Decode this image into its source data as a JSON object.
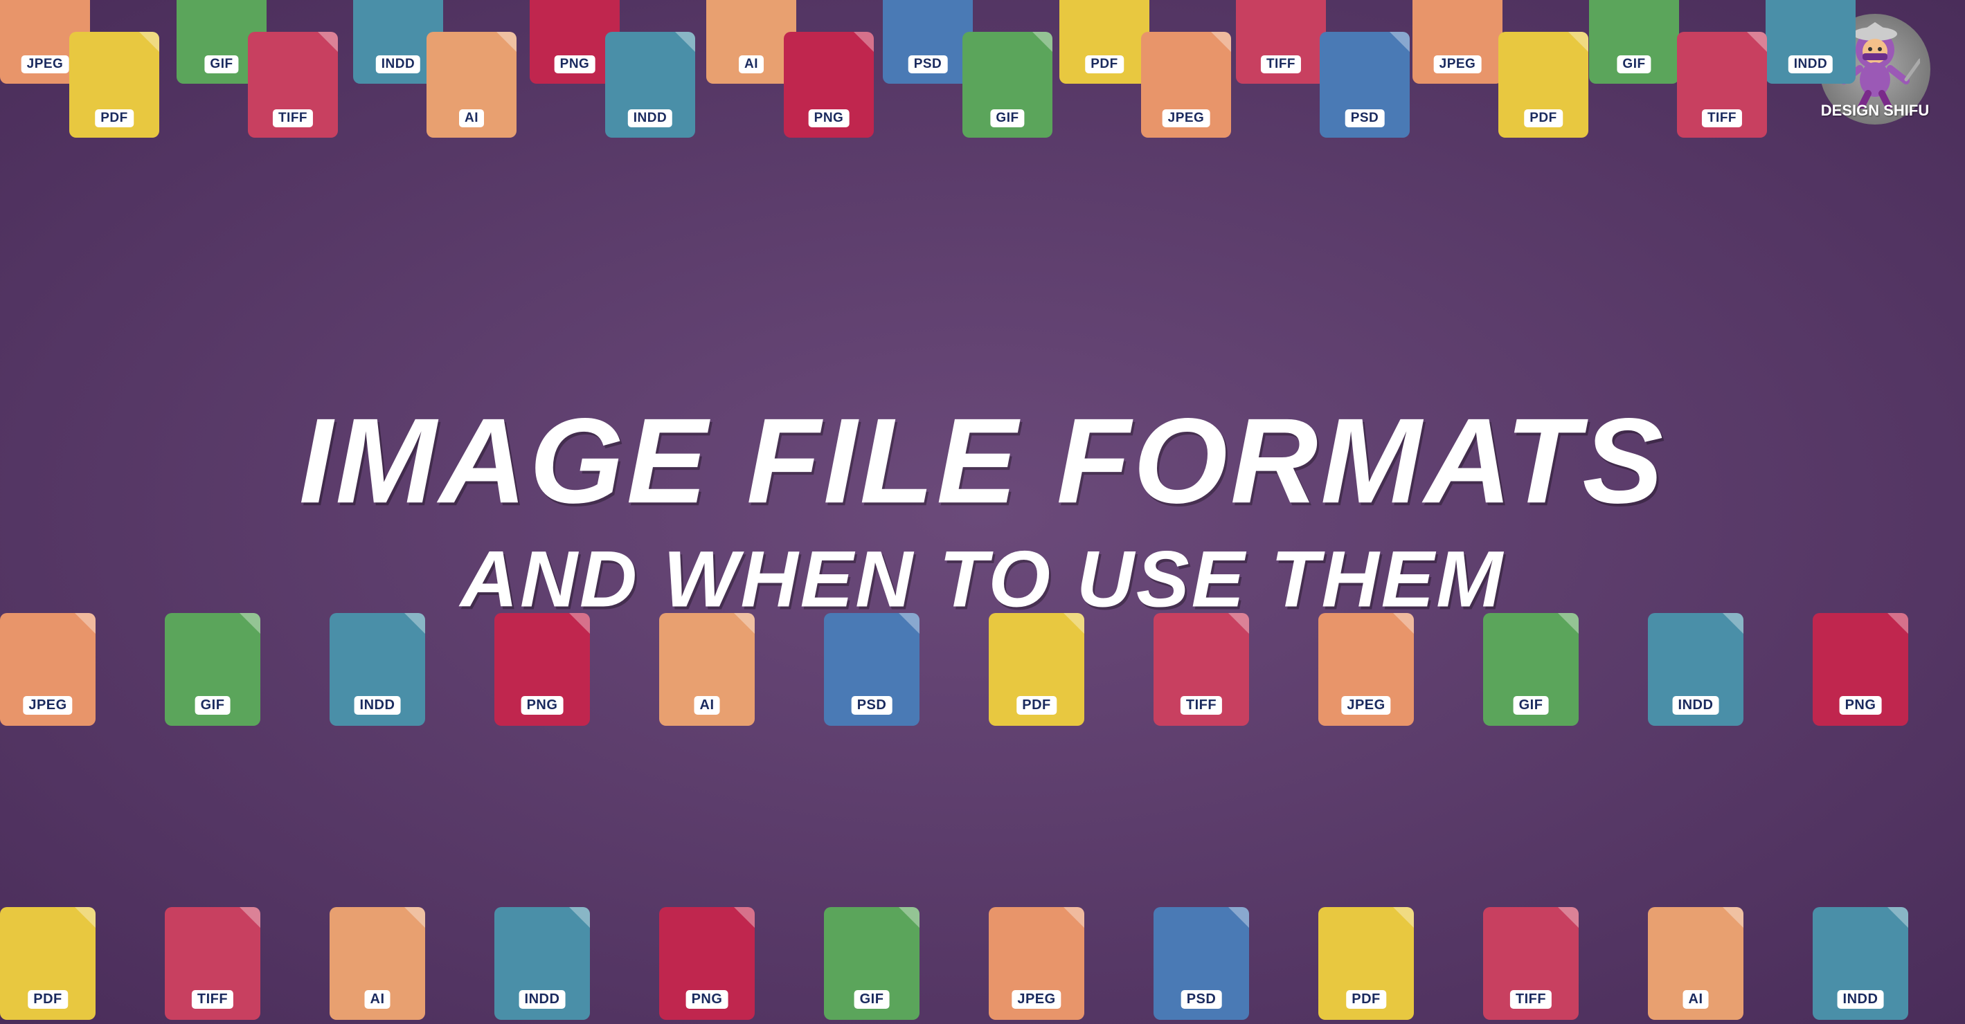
{
  "background_color": "#5c3a6b",
  "title": {
    "line1": "IMAGE FILE FORMATS",
    "line2": "AND WHEN TO USE THEM"
  },
  "logo": {
    "brand": "DESIGN\nSHIFU"
  },
  "file_types": {
    "colors": {
      "JPEG": "#e8956a",
      "GIF": "#5ba55b",
      "INDD": "#4a8fa8",
      "PNG": "#c0264e",
      "AI": "#e8a070",
      "PSD": "#4a7ab5",
      "PDF": "#e8c840",
      "TIFF": "#c84060",
      "JPEG2": "#e8956a"
    }
  },
  "rows": {
    "row1": [
      "JPEG",
      "GIF",
      "INDD",
      "PNG",
      "AI",
      "PSD",
      "PDF",
      "TIFF",
      "JPEG",
      "GIF"
    ],
    "row2": [
      "PDF",
      "TIFF",
      "AI",
      "INDD",
      "PNG",
      "GIF",
      "JPEG",
      "PSD",
      "PDF",
      "TIFF"
    ],
    "row3": [
      "JPEG",
      "GIF",
      "INDD",
      "PNG",
      "AI",
      "PSD",
      "PDF",
      "TIFF",
      "JPEG",
      "GIF",
      "INDD",
      "PNG"
    ],
    "row4": [
      "PDF",
      "TIFF",
      "AI",
      "INDD",
      "PNG",
      "GIF",
      "JPEG",
      "PSD",
      "PDF",
      "TIFF",
      "AI",
      "INDD"
    ]
  }
}
